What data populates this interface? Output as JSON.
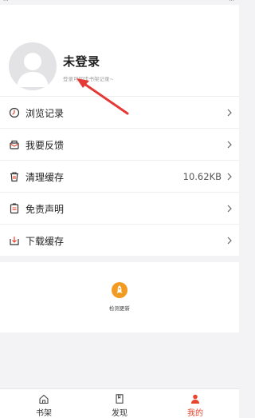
{
  "status_bar": {
    "left": "...",
    "right": "..."
  },
  "profile": {
    "title": "未登录",
    "subtitle": "登录可同步书架记录~"
  },
  "menu": {
    "items": [
      {
        "label": "浏览记录",
        "icon": "clock-icon"
      },
      {
        "label": "我要反馈",
        "icon": "feedback-icon"
      },
      {
        "label": "清理缓存",
        "icon": "trash-icon",
        "value": "10.62KB"
      },
      {
        "label": "免责声明",
        "icon": "document-icon"
      },
      {
        "label": "下载缓存",
        "icon": "download-icon"
      }
    ]
  },
  "update": {
    "label": "检测更新",
    "icon": "rocket-icon"
  },
  "tabs": [
    {
      "label": "书架",
      "icon": "home-icon",
      "active": false
    },
    {
      "label": "发现",
      "icon": "book-icon",
      "active": false
    },
    {
      "label": "我的",
      "icon": "person-icon",
      "active": true
    }
  ],
  "colors": {
    "accent": "#e8452d",
    "update_icon": "#f39a22",
    "annotation_arrow": "#e53935"
  }
}
